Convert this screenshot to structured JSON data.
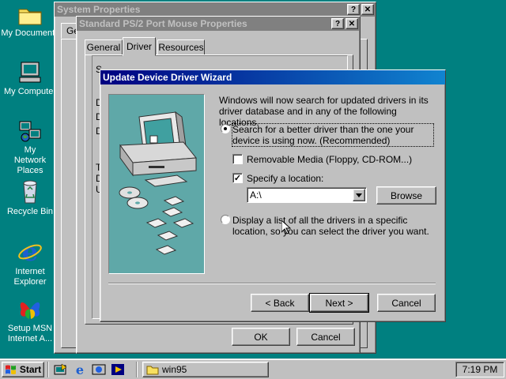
{
  "desktop": {
    "icons": [
      {
        "label": "My Documents",
        "icon": "folder-icon"
      },
      {
        "label": "My Computer",
        "icon": "computer-icon"
      },
      {
        "label": "My Network Places",
        "icon": "network-icon"
      },
      {
        "label": "Recycle Bin",
        "icon": "recycle-bin-icon"
      },
      {
        "label": "Internet Explorer",
        "icon": "internet-explorer-icon"
      },
      {
        "label": "Setup MSN Internet A...",
        "icon": "msn-butterfly-icon"
      }
    ]
  },
  "system_properties": {
    "title": "System Properties",
    "tab_partial": "Ge",
    "help_btn": "?",
    "close_btn": "✕"
  },
  "mouse_properties": {
    "title": "Standard PS/2 Port Mouse Properties",
    "tabs": [
      "General",
      "Driver",
      "Resources"
    ],
    "help_btn": "?",
    "close_btn": "✕",
    "ok": "OK",
    "cancel": "Cancel",
    "partial_letters": [
      "S",
      "D",
      "D",
      "D",
      "T",
      "D",
      "U"
    ]
  },
  "wizard": {
    "title": "Update Device Driver Wizard",
    "intro": "Windows will now search for updated drivers in its driver database and in any of the following locations.",
    "option_search": "Search for a better driver than the one your device is using now. (Recommended)",
    "removable_media": "Removable Media (Floppy, CD-ROM...)",
    "specify_location": "Specify a location:",
    "location_value": "A:\\",
    "browse": "Browse",
    "option_list": "Display a list of all the drivers in a specific location, so you can select the driver you want.",
    "back": "< Back",
    "next": "Next >",
    "cancel": "Cancel",
    "removable_checked": false,
    "specify_checked": true,
    "selected_option": "search"
  },
  "taskbar": {
    "start": "Start",
    "quicklaunch": [
      "show-desktop-icon",
      "ie-quicklaunch-icon",
      "channels-icon",
      "media-player-icon"
    ],
    "task_label": "win95",
    "clock": "7:19 PM"
  }
}
